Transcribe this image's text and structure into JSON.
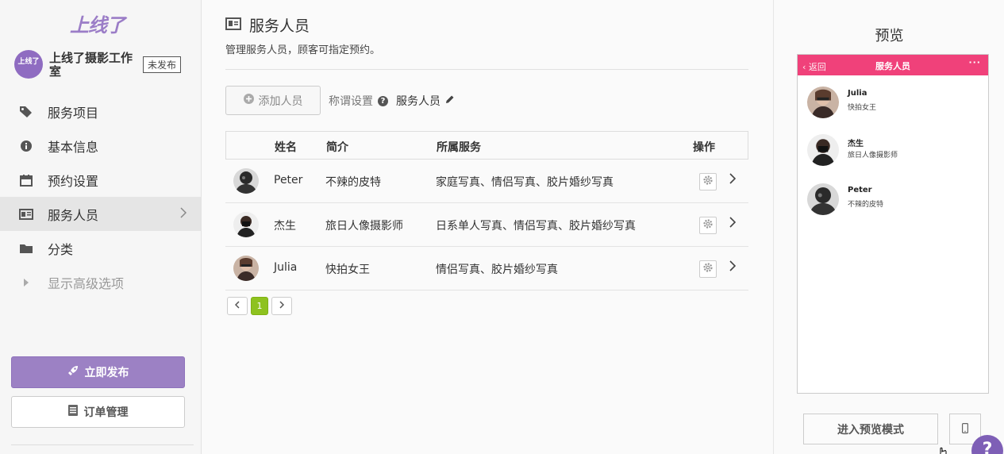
{
  "brand": {
    "logo_text": "上线了"
  },
  "business": {
    "avatar_text": "上线了",
    "name": "上线了摄影工作室",
    "status_badge": "未发布"
  },
  "sidebar": {
    "items": [
      {
        "label": "服务项目",
        "icon": "tags-icon"
      },
      {
        "label": "基本信息",
        "icon": "info-icon"
      },
      {
        "label": "预约设置",
        "icon": "calendar-icon"
      },
      {
        "label": "服务人员",
        "icon": "id-card-icon",
        "active": true
      },
      {
        "label": "分类",
        "icon": "folder-icon"
      },
      {
        "label": "显示高级选项",
        "icon": "caret-right-icon"
      }
    ],
    "publish_label": "立即发布",
    "orders_label": "订单管理",
    "footer_left": "——",
    "footer_right": "——"
  },
  "main": {
    "title": "服务人员",
    "description": "管理服务人员，顾客可指定预约。",
    "add_button": "添加人员",
    "title_setting_label": "称谓设置",
    "current_title": "服务人员",
    "table": {
      "headers": {
        "name": "姓名",
        "intro": "简介",
        "services": "所属服务",
        "actions": "操作"
      },
      "rows": [
        {
          "name": "Peter",
          "intro": "不辣的皮特",
          "services": "家庭写真、情侣写真、胶片婚纱写真"
        },
        {
          "name": "杰生",
          "intro": "旅日人像摄影师",
          "services": "日系单人写真、情侣写真、胶片婚纱写真"
        },
        {
          "name": "Julia",
          "intro": "快拍女王",
          "services": "情侣写真、胶片婚纱写真"
        }
      ]
    },
    "pagination": {
      "current_page": "1"
    }
  },
  "preview": {
    "title": "预览",
    "phone": {
      "back_label": "返回",
      "title": "服务人员",
      "more": "···",
      "items": [
        {
          "name": "Julia",
          "desc": "快拍女王"
        },
        {
          "name": "杰生",
          "desc": "旅日人像摄影师"
        },
        {
          "name": "Peter",
          "desc": "不辣的皮特"
        }
      ]
    },
    "enter_preview_label": "进入预览模式",
    "help_label": "?"
  },
  "colors": {
    "accent": "#9c81c4",
    "phone_bar": "#f0417a",
    "page_active": "#8ec21f"
  }
}
